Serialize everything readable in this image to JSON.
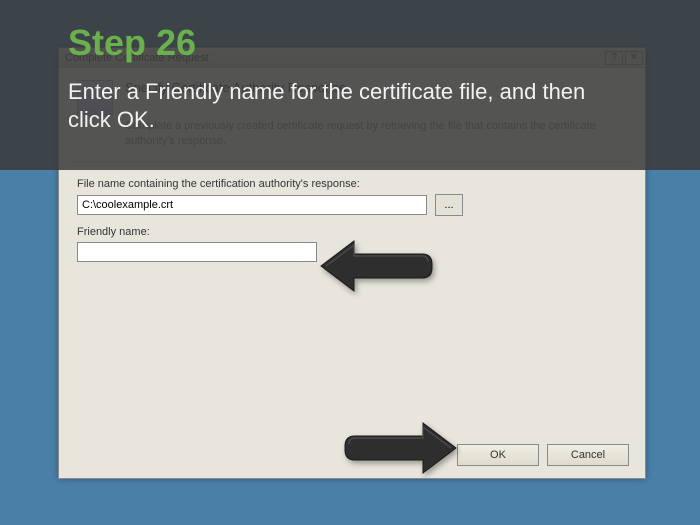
{
  "overlay": {
    "step_label": "Step 26",
    "instruction": "Enter a Friendly name for the certificate file, and then click OK."
  },
  "dialog": {
    "title": "Complete Certificate Request",
    "header": "Specify Certificate Authority Response",
    "description": "Complete a previously created certificate request by retrieving the file that contains the certificate authority's response.",
    "file_label": "File name containing the certification authority's response:",
    "file_value": "C:\\coolexample.crt",
    "browse_label": "...",
    "friendly_label": "Friendly name:",
    "friendly_value": "",
    "ok_label": "OK",
    "cancel_label": "Cancel",
    "help_symbol": "?",
    "close_symbol": "✕"
  }
}
